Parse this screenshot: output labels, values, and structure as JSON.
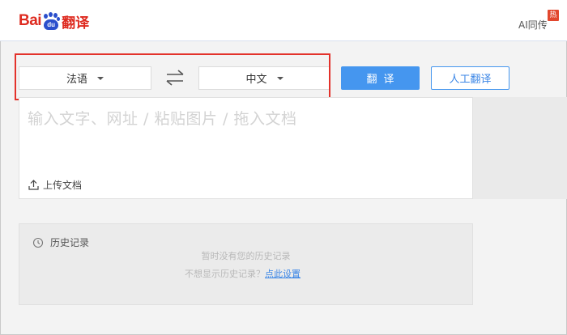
{
  "header": {
    "logo_bai": "Bai",
    "logo_du": "du",
    "logo_fanyi": "翻译",
    "ai_link": "AI同传",
    "hot_badge": "热"
  },
  "toolbar": {
    "source_lang": "法语",
    "target_lang": "中文",
    "translate_label": "翻译",
    "human_translate_label": "人工翻译"
  },
  "input": {
    "placeholder": "输入文字、网址 / 粘贴图片 / 拖入文档",
    "upload_label": "上传文档"
  },
  "history": {
    "title": "历史记录",
    "empty_text": "暂时没有您的历史记录",
    "hint_text": "不想显示历史记录？",
    "hint_link": "点此设置"
  },
  "colors": {
    "brand_red": "#de2a1f",
    "brand_blue": "#2b4fcc",
    "accent": "#4596ef",
    "highlight_outline": "#e3322b"
  },
  "icons": {
    "swap": "swap-arrows-icon",
    "upload": "upload-icon",
    "history": "clock-icon",
    "caret": "caret-down-icon"
  }
}
